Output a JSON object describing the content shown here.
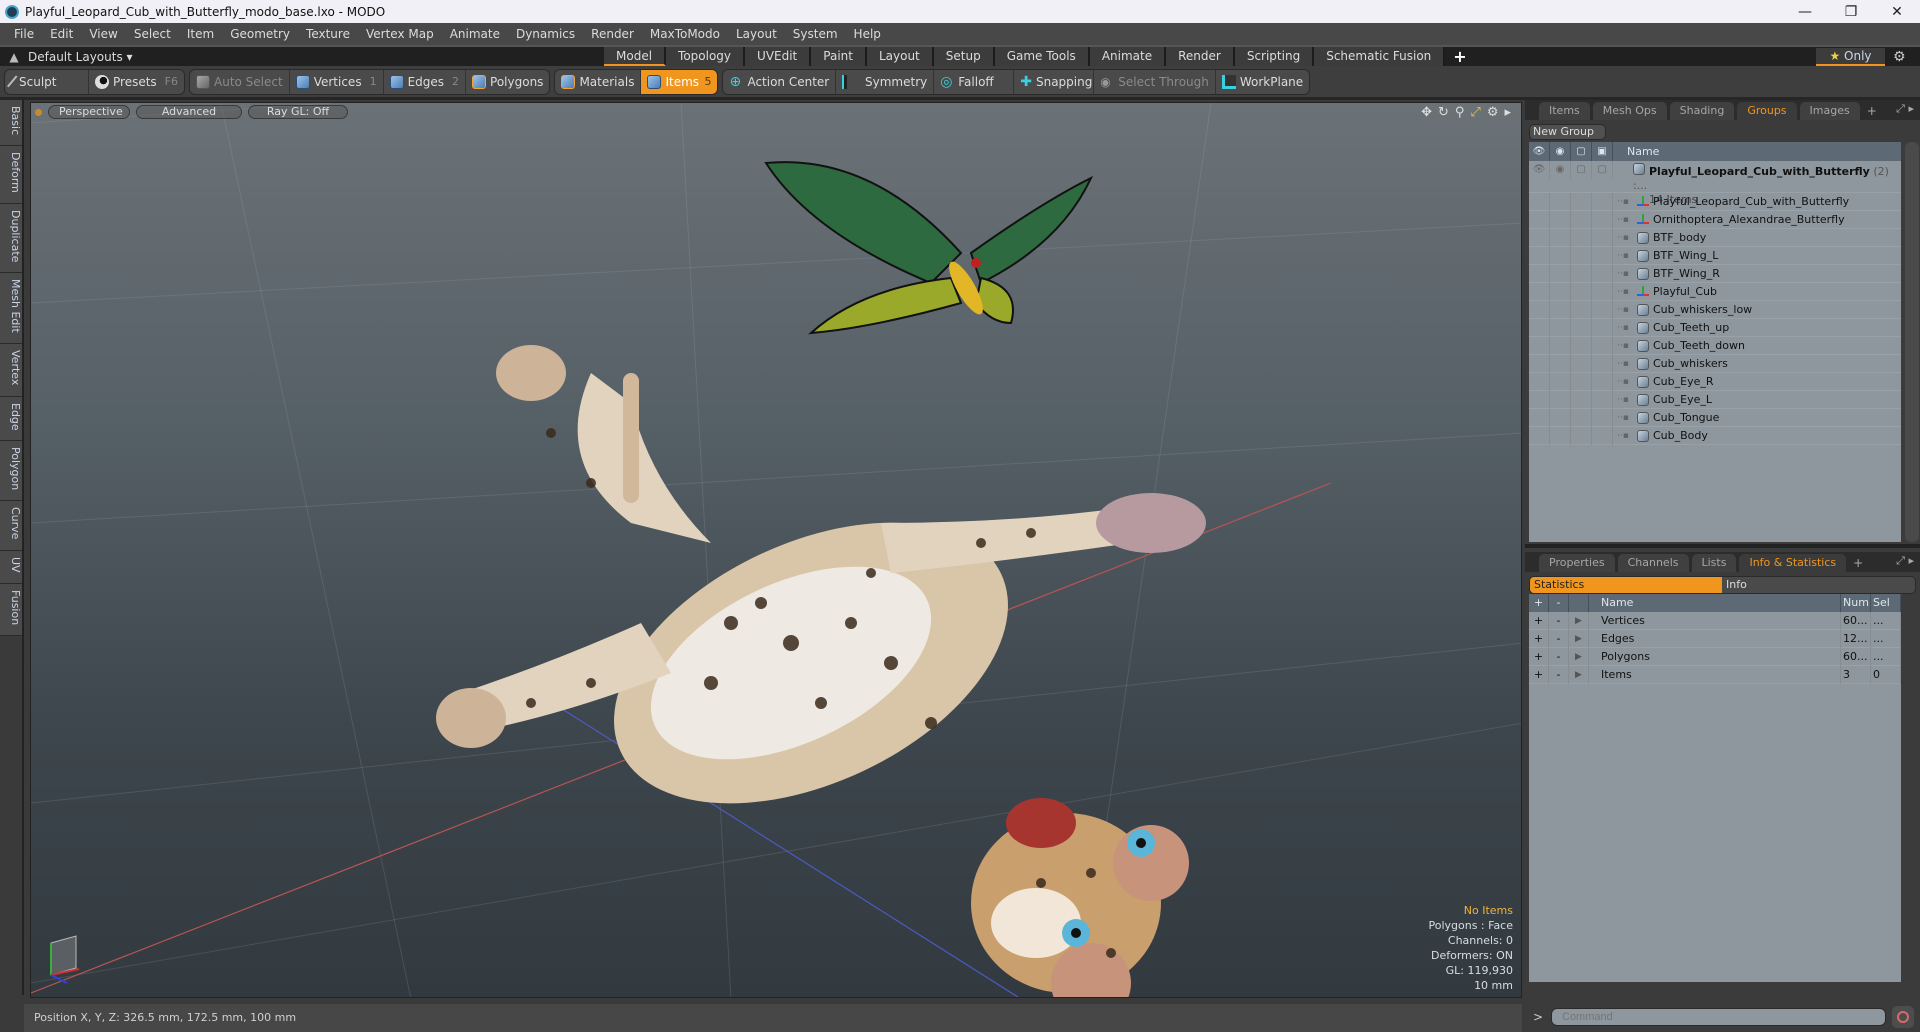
{
  "window": {
    "title": "Playful_Leopard_Cub_with_Butterfly_modo_base.lxo - MODO",
    "controls": [
      "minimize",
      "maximize",
      "close"
    ]
  },
  "menu": [
    "File",
    "Edit",
    "View",
    "Select",
    "Item",
    "Geometry",
    "Texture",
    "Vertex Map",
    "Animate",
    "Dynamics",
    "Render",
    "MaxToModo",
    "Layout",
    "System",
    "Help"
  ],
  "layoutbar": {
    "layout_label": "Default Layouts ▾",
    "tabs": [
      "Model",
      "Topology",
      "UVEdit",
      "Paint",
      "Layout",
      "Setup",
      "Game Tools",
      "Animate",
      "Render",
      "Scripting",
      "Schematic Fusion"
    ],
    "active_tab": "Model",
    "add_tab": "+",
    "only_label": "Only",
    "only_star": "★"
  },
  "toolbar": {
    "sculpt": "Sculpt",
    "presets": "Presets",
    "presets_key": "F6",
    "auto_select": "Auto Select",
    "vertices": "Vertices",
    "vertices_key": "1",
    "edges": "Edges",
    "edges_key": "2",
    "polygons": "Polygons",
    "materials": "Materials",
    "items": "Items",
    "items_key": "5",
    "action_center": "Action Center",
    "symmetry": "Symmetry",
    "falloff": "Falloff",
    "snapping": "Snapping",
    "select_through": "Select Through",
    "workplane": "WorkPlane"
  },
  "left_tabs": [
    "Basic",
    "Deform",
    "Duplicate",
    "Mesh Edit",
    "Vertex",
    "Edge",
    "Polygon",
    "Curve",
    "UV",
    "Fusion"
  ],
  "viewport": {
    "view_mode": "Perspective",
    "advanced": "Advanced",
    "raygl": "Ray GL: Off",
    "info": {
      "selection": "No Items",
      "polygons": "Polygons : Face",
      "channels": "Channels: 0",
      "deformers": "Deformers: ON",
      "gl": "GL: 119,930",
      "grid": "10 mm"
    },
    "scene_objects": [
      "leopard cub",
      "butterfly"
    ]
  },
  "status": {
    "position": "Position X, Y, Z:   326.5 mm, 172.5 mm, 100 mm"
  },
  "groups_panel": {
    "tabs": [
      "Items",
      "Mesh Ops",
      "Shading",
      "Groups",
      "Images"
    ],
    "active_tab": "Groups",
    "new_group": "New Group",
    "column_name": "Name",
    "root": {
      "name": "Playful_Leopard_Cub_with_Butterfly",
      "suffix": "(2) :...",
      "count": "14 Items"
    },
    "items": [
      {
        "name": "Playful_Leopard_Cub_with_Butterfly",
        "type": "locator"
      },
      {
        "name": "Ornithoptera_Alexandrae_Butterfly",
        "type": "locator"
      },
      {
        "name": "BTF_body",
        "type": "mesh"
      },
      {
        "name": "BTF_Wing_L",
        "type": "mesh"
      },
      {
        "name": "BTF_Wing_R",
        "type": "mesh"
      },
      {
        "name": "Playful_Cub",
        "type": "locator"
      },
      {
        "name": "Cub_whiskers_low",
        "type": "mesh"
      },
      {
        "name": "Cub_Teeth_up",
        "type": "mesh"
      },
      {
        "name": "Cub_Teeth_down",
        "type": "mesh"
      },
      {
        "name": "Cub_whiskers",
        "type": "mesh"
      },
      {
        "name": "Cub_Eye_R",
        "type": "mesh"
      },
      {
        "name": "Cub_Eye_L",
        "type": "mesh"
      },
      {
        "name": "Cub_Tongue",
        "type": "mesh"
      },
      {
        "name": "Cub_Body",
        "type": "mesh"
      }
    ]
  },
  "stats_panel": {
    "tabs": [
      "Properties",
      "Channels",
      "Lists",
      "Info & Statistics"
    ],
    "active_tab": "Info & Statistics",
    "subtabs": [
      "Statistics",
      "Info"
    ],
    "active_subtab": "Statistics",
    "columns": {
      "plus": "+",
      "minus": "-",
      "name": "Name",
      "num": "Num",
      "sel": "Sel"
    },
    "rows": [
      {
        "name": "Vertices",
        "num": "60...",
        "sel": "..."
      },
      {
        "name": "Edges",
        "num": "12...",
        "sel": "..."
      },
      {
        "name": "Polygons",
        "num": "60...",
        "sel": "..."
      },
      {
        "name": "Items",
        "num": "3",
        "sel": "0"
      }
    ]
  },
  "command": {
    "prompt": ">",
    "placeholder": "Command"
  },
  "colors": {
    "accent": "#f0961e",
    "info_highlight": "#f3b23c"
  }
}
